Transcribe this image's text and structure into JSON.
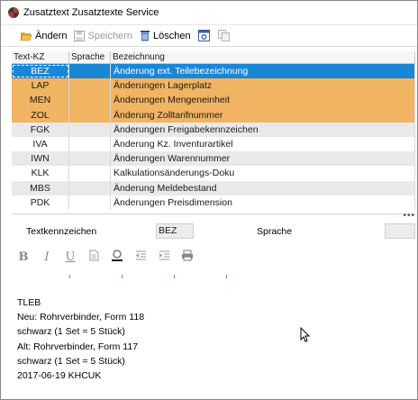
{
  "window": {
    "title": "Zusatztext Zusatztexte Service"
  },
  "toolbar": {
    "edit_label": "Ändern",
    "save_label": "Speichern",
    "delete_label": "Löschen"
  },
  "grid": {
    "headers": [
      "Text-KZ",
      "Sprache",
      "Bezeichnung"
    ],
    "rows": [
      {
        "kz": "BEZ",
        "sprache": "",
        "bezeichnung": "Änderung ext. Teilebezeichnung",
        "state": "selected"
      },
      {
        "kz": "LAP",
        "sprache": "",
        "bezeichnung": "Änderungen Lagerplatz",
        "state": "highlighted"
      },
      {
        "kz": "MEN",
        "sprache": "",
        "bezeichnung": "Änderungen       Mengeneinheit",
        "state": "highlighted"
      },
      {
        "kz": "ZOL",
        "sprache": "",
        "bezeichnung": "Änderung Zolltarifnummer",
        "state": "highlighted"
      },
      {
        "kz": "FGK",
        "sprache": "",
        "bezeichnung": "Änderungen Freigabekennzeichen",
        "state": "gray"
      },
      {
        "kz": "IVA",
        "sprache": "",
        "bezeichnung": "Änderung Kz. Inventurartikel",
        "state": "white"
      },
      {
        "kz": "IWN",
        "sprache": "",
        "bezeichnung": "Änderungen Warennummer",
        "state": "gray"
      },
      {
        "kz": "KLK",
        "sprache": "",
        "bezeichnung": "Kalkulationsänderungs-Doku",
        "state": "white"
      },
      {
        "kz": "MBS",
        "sprache": "",
        "bezeichnung": "Änderung Meldebestand",
        "state": "gray"
      },
      {
        "kz": "PDK",
        "sprache": "",
        "bezeichnung": "Änderungen Preisdimension",
        "state": "white"
      }
    ]
  },
  "form": {
    "textkennzeichen_label": "Textkennzeichen",
    "textkennzeichen_value": "BEZ",
    "sprache_label": "Sprache",
    "sprache_value": ""
  },
  "editor": {
    "lines": [
      "TLEB",
      "Neu: Rohrverbinder, Form 118",
      "schwarz (1 Set = 5 Stück)",
      "Alt: Rohrverbinder, Form 117",
      "schwarz (1 Set = 5 Stück)",
      "2017-06-19 KHCUK"
    ]
  },
  "colors": {
    "selected": "#1a86d6",
    "highlighted": "#f0b462",
    "gray_row": "#e9e9e9"
  }
}
